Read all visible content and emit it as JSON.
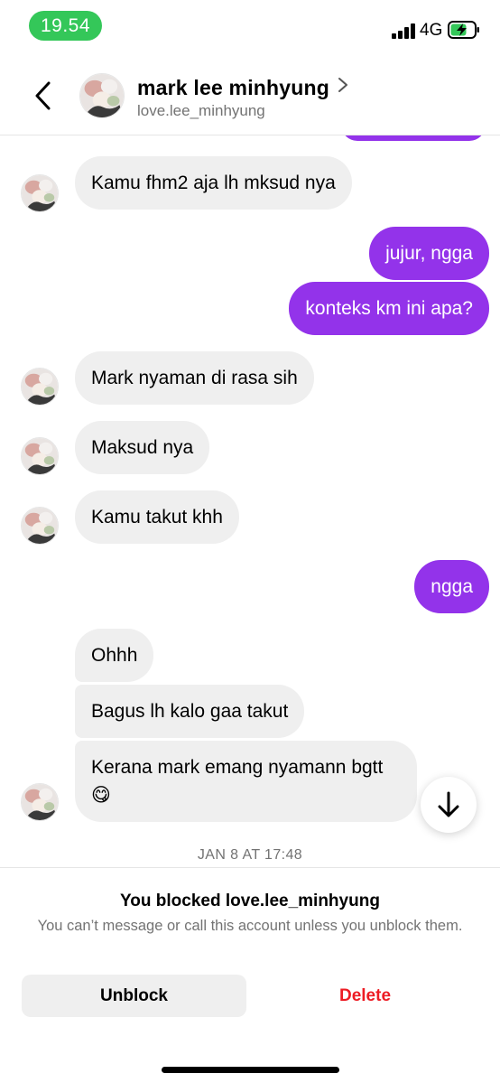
{
  "status_bar": {
    "time": "19.54",
    "network": "4G"
  },
  "header": {
    "name": "mark lee minhyung",
    "username": "love.lee_minhyung"
  },
  "messages": [
    {
      "side": "in",
      "text": "Kamu fhm2 aja lh mksud nya",
      "avatar": true
    },
    {
      "side": "out",
      "text": "jujur, ngga"
    },
    {
      "side": "out",
      "text": "konteks km ini apa?"
    },
    {
      "side": "in",
      "text": "Mark nyaman di rasa sih",
      "avatar": true
    },
    {
      "side": "in",
      "text": "Maksud nya",
      "avatar": true
    },
    {
      "side": "in",
      "text": "Kamu takut khh",
      "avatar": true
    },
    {
      "side": "out",
      "text": "ngga"
    },
    {
      "side": "in",
      "text": "Ohhh",
      "avatar": false
    },
    {
      "side": "in",
      "text": "Bagus lh kalo gaa takut",
      "avatar": false
    },
    {
      "side": "in",
      "text": "Kerana mark emang nyamann bgtt",
      "emoji": "😋",
      "avatar": true
    }
  ],
  "timestamp": "JAN 8 AT 17:48",
  "blocked": {
    "title": "You blocked love.lee_minhyung",
    "description": "You can’t message or call this account unless you unblock them.",
    "unblock_label": "Unblock",
    "delete_label": "Delete"
  },
  "colors": {
    "outgoing_bubble": "#9333ea",
    "incoming_bubble": "#efefef",
    "time_pill": "#34c759",
    "delete": "#ed1c24"
  },
  "icons": {
    "back": "chevron-left-icon",
    "profile_link": "chevron-right-icon",
    "scroll": "arrow-down-icon"
  }
}
